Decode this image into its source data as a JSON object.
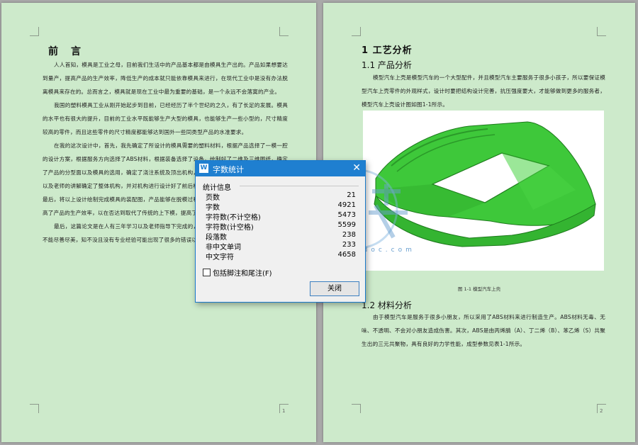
{
  "left_page": {
    "heading": "前　言",
    "paragraphs": [
      "人人首知，模具是工业之母，目前我们生活中的产品基本都是由模具生产出的。产品如果想要达到量产，提高产品的生产效率，降低生产的成本就只能依靠模具来进行，在现代工业中是没有办法脱离模具来存在的。总而言之，模具就是现在工业中最为重要的基础，是一个永远不会落寞的产业。",
      "我国的塑料模具工业从刚开始起步到目前，已经经历了半个世纪的之久，有了长足的发展。模具的水平也有很大的提升，目前的工业水平既能够生产大型的模具，也能够生产一些小型的，尺寸精度较高的零件，而且这些零件的尺寸精度都能够达到国外一些同类型产品的水准要求。",
      "在我的这次设计中，首先，我先确定了所设计的模具需要的塑料材料，根据产品选择了一模一腔的设计方案，根据服务方向选择了ABS材料，根据装备选择了设备，绘制好了二维及三维图纸，确定了产品的分型面以及模具的选用，确定了浇注系统及顶出机构，进行了注塑机的选用，根据书本知识以及老师的讲解确定了整体机构，并对机构进行设计好了前后模冷却水路设计以及热流道浇注系统；最后，将以上设计绘制完成模具的装配图，产品能够在脱模过程中更好的脱模，利用滑块的设计，提高了产品的生产效率，以在否达到取代了传统的上下模，提高了产品的生产效率。",
      "最后，这篇论文是在人有三年学习以及老师指导下完成的，设计中难免会有一些不足之处，加之不能尽善尽美，知不没且没有专业经验可能出现了很多的错误以及不足，还请各位老师批评指正。"
    ],
    "page_number": "1"
  },
  "right_page": {
    "h1": "1  工艺分析",
    "h2_1": "1.1  产品分析",
    "para1": "模型汽车上壳是模型汽车的一个大型配件，并且模型汽车主要服务于很多小孩子，所以要保证模型汽车上壳零件的外观样式，设计时要把结构设计完善，抗压强度要大，才能够做到更多的服务者，模型汽车上壳设计图如图1-1所示。",
    "figure_caption": "图 1-1 模型汽车上壳",
    "h2_2": "1.2  材料分析",
    "para2": "由于模型汽车是服务于很多小朋友，所以采用了ABS材料来进行制造生产。ABS材料无毒、无味、不透明、不会对小朋友造成伤害。其次，ABS是由丙烯腈（A）、丁二烯（B）、苯乙烯（S）共聚生出的三元共聚物，具有良好的力学性能，成型参数见表1-1所示。",
    "page_number": "2"
  },
  "watermark": {
    "logo_text": "人人文库",
    "url_text": "www.renrendoc.com"
  },
  "dialog": {
    "title": "字数统计",
    "group_label": "统计信息",
    "stats": [
      {
        "label": "页数",
        "value": "21"
      },
      {
        "label": "字数",
        "value": "4921"
      },
      {
        "label": "字符数(不计空格)",
        "value": "5473"
      },
      {
        "label": "字符数(计空格)",
        "value": "5599"
      },
      {
        "label": "段落数",
        "value": "238"
      },
      {
        "label": "非中文单词",
        "value": "233"
      },
      {
        "label": "中文字符",
        "value": "4658"
      }
    ],
    "checkbox_label": "包括脚注和尾注(F)",
    "checkbox_checked": false,
    "close_button": "关闭",
    "close_x": "✕",
    "app_icon": "W"
  },
  "colors": {
    "page_background": "#cdeacb",
    "workspace": "#a9a9a9",
    "dialog_titlebar": "#1f7fd0",
    "car_green": "#3ec83a"
  }
}
